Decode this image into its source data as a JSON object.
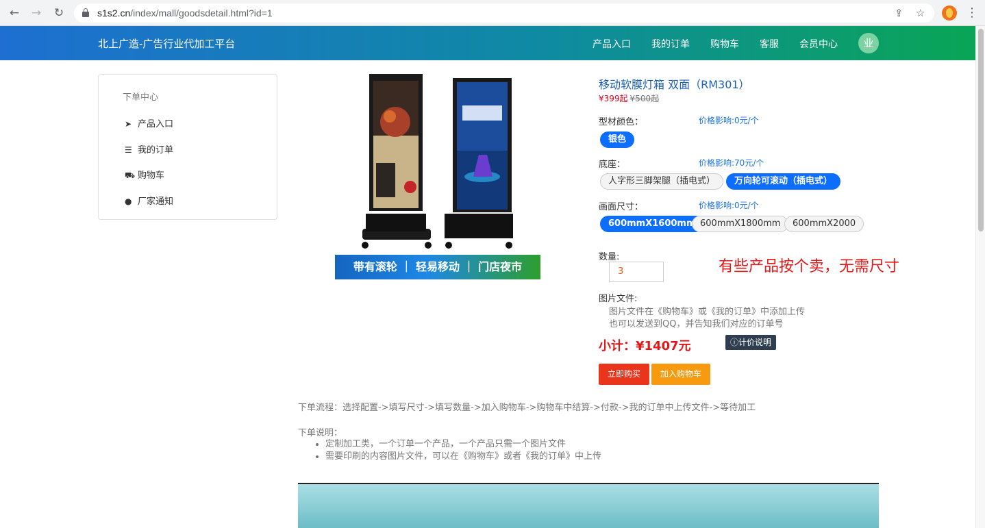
{
  "browser": {
    "url_host": "s1s2.cn",
    "url_path": "/index/mall/goodsdetail.html?id=1"
  },
  "header": {
    "brand": "北上广造-广告行业代加工平台",
    "nav": [
      "产品入口",
      "我的订单",
      "购物车",
      "客服",
      "会员中心"
    ],
    "avatar_text": "业"
  },
  "sidebar": {
    "title": "下单中心",
    "items": [
      {
        "label": "产品入口",
        "icon": "paper-plane-icon"
      },
      {
        "label": "我的订单",
        "icon": "list-icon"
      },
      {
        "label": "购物车",
        "icon": "cart-icon"
      },
      {
        "label": "厂家通知",
        "icon": "comment-icon"
      }
    ]
  },
  "product": {
    "title": "移动软膜灯箱 双面（RM301）",
    "price_now": "¥399起",
    "price_old": "¥500起",
    "image_banner": "带有滚轮 ｜ 轻易移动 ｜ 门店夜市",
    "options": [
      {
        "label": "型材颜色：",
        "note": "价格影响:0元/个",
        "choices": [
          "银色"
        ],
        "selected": 0
      },
      {
        "label": "底座：",
        "note": "价格影响:70元/个",
        "choices": [
          "人字形三脚架腿（插电式）",
          "万向轮可滚动（插电式）"
        ],
        "selected": 1
      },
      {
        "label": "画面尺寸：",
        "note": "价格影响:0元/个",
        "choices": [
          "600mmX1600mm",
          "600mmX1800mm",
          "600mmX2000"
        ],
        "selected": 0
      }
    ],
    "qty_label": "数量:",
    "qty_value": "3",
    "annotation": "有些产品按个卖，无需尺寸",
    "file_label": "图片文件:",
    "file_notes": [
      "图片文件在《购物车》或《我的订单》中添加上传",
      "也可以发送到QQ，并告知我们对应的订单号"
    ],
    "subtotal": "小计：¥1407元",
    "pricing_button": "计价说明",
    "buy_button": "立即购买",
    "cart_button": "加入购物车"
  },
  "flow": "下单流程：选择配置->填写尺寸->填写数量->加入购物车->购物车中结算->付款->我的订单中上传文件->等待加工",
  "instructions": {
    "title": "下单说明：",
    "items": [
      "定制加工类，一个订单一个产品，一个产品只需一个图片文件",
      "需要印刷的内容图片文件，可以在《购物车》或者《我的订单》中上传"
    ]
  },
  "colors": {
    "header_start": "#1e6fd1",
    "header_end": "#0aa556",
    "primary": "#0d6efd",
    "buy": "#e8351c",
    "cart": "#f89a10",
    "accent_red": "#e31919"
  }
}
